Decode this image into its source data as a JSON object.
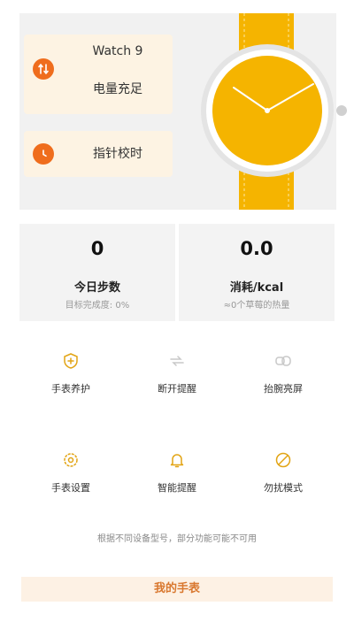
{
  "device": {
    "name": "Watch 9",
    "battery_status": "电量充足",
    "calibrate_label": "指针校时"
  },
  "stats": {
    "steps": {
      "value": "0",
      "label": "今日步数",
      "sub": "目标完成度: 0%"
    },
    "calories": {
      "value": "0.0",
      "label": "消耗/kcal",
      "sub": "≈0个草莓的热量"
    }
  },
  "features": [
    {
      "label": "手表养护",
      "icon": "shield-plus-icon"
    },
    {
      "label": "断开提醒",
      "icon": "disconnect-icon"
    },
    {
      "label": "抬腕亮屏",
      "icon": "wrist-raise-icon"
    },
    {
      "label": "手表设置",
      "icon": "gear-icon"
    },
    {
      "label": "智能提醒",
      "icon": "bell-icon"
    },
    {
      "label": "勿扰模式",
      "icon": "do-not-disturb-icon"
    }
  ],
  "note": "根据不同设备型号，部分功能可能不可用",
  "bottom_button": "我的手表",
  "colors": {
    "accent": "#ef6d1d",
    "watch_yellow": "#f5b400",
    "icon_gold": "#e2a414",
    "icon_gray": "#c8c8c8",
    "card_bg": "#fdf3e3"
  }
}
